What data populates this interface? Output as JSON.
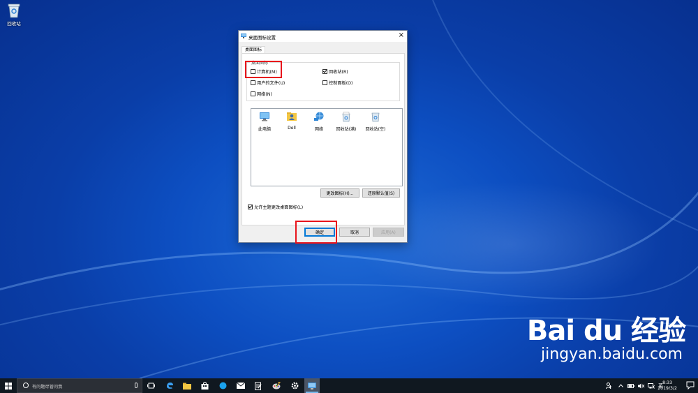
{
  "desktop": {
    "recycle_bin_label": "回收站"
  },
  "dialog": {
    "title": "桌面图标设置",
    "close_glyph": "×",
    "tab_label": "桌面图标",
    "group_legend": "桌面图标",
    "checkboxes": [
      {
        "label": "计算机(M)",
        "checked": false
      },
      {
        "label": "回收站(R)",
        "checked": true
      },
      {
        "label": "用户的文件(U)",
        "checked": false
      },
      {
        "label": "控制面板(O)",
        "checked": false
      },
      {
        "label": "网络(N)",
        "checked": false
      }
    ],
    "icon_list": [
      "此电脑",
      "Dell",
      "网络",
      "回收站(满)",
      "回收站(空)"
    ],
    "change_icon_button": "更改图标(H)...",
    "restore_default_button": "还原默认值(S)",
    "allow_theme_label": "允许主题更改桌面图标(L)",
    "allow_theme_checked": true,
    "ok_button": "确定",
    "cancel_button": "取消",
    "apply_button": "应用(A)"
  },
  "watermark": {
    "brand": "Bai du 经验",
    "url": "jingyan.baidu.com"
  },
  "taskbar": {
    "search_placeholder": "有问题尽管问我",
    "tray_lang": "英",
    "time": "8:33",
    "date": "2019/3/2",
    "apps": [
      "task-view",
      "edge",
      "file-explorer",
      "store",
      "safari",
      "mail",
      "notepad",
      "paint-tool",
      "settings",
      "desktop-icon-settings"
    ]
  },
  "colors": {
    "highlight_red": "#e8141c",
    "accent_blue": "#0078d7",
    "taskbar": "#101820"
  }
}
